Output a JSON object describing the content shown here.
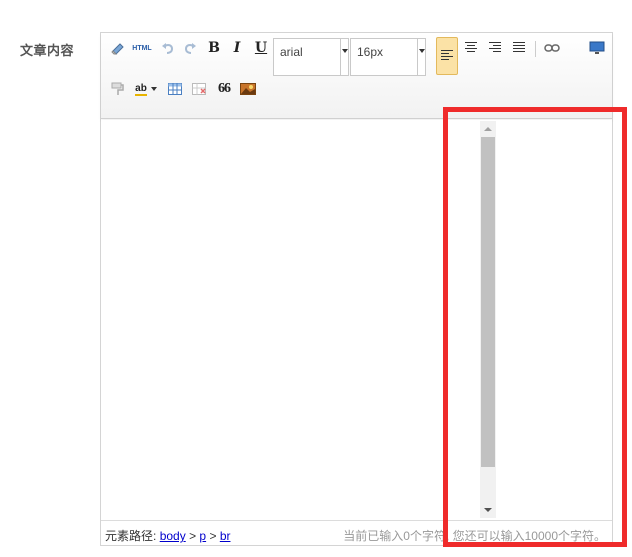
{
  "form": {
    "field_label": "文章内容"
  },
  "toolbar": {
    "html_label": "HTML",
    "bold_label": "B",
    "italic_label": "I",
    "underline_label": "U",
    "font_family_value": "arial",
    "font_size_value": "16px",
    "quote_label": "66",
    "spellcheck_label": "ab"
  },
  "statusbar": {
    "path_prefix": "元素路径:",
    "path_items": [
      "body",
      "p",
      "br"
    ],
    "path_sep": ">",
    "word_count": "当前已输入0个字符, 您还可以输入10000个字符。"
  },
  "colors": {
    "highlight": "#ef2b2b",
    "active_button": "#fbe2a6",
    "scroll_thumb": "#c1c1c1"
  }
}
